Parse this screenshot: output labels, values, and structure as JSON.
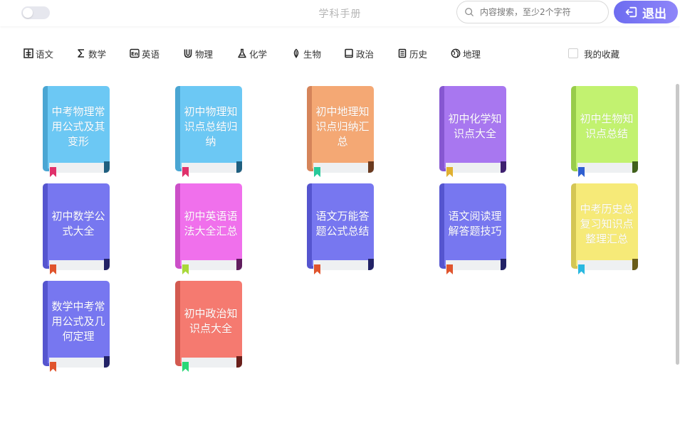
{
  "header": {
    "title": "学科手册",
    "search_placeholder": "内容搜索，至少2个字符",
    "logout_label": "退出"
  },
  "subjects": [
    {
      "label": "语文",
      "icon": "chinese-book-icon"
    },
    {
      "label": "数学",
      "icon": "sigma-icon"
    },
    {
      "label": "英语",
      "icon": "english-en-icon"
    },
    {
      "label": "物理",
      "icon": "magnet-icon"
    },
    {
      "label": "化学",
      "icon": "flask-icon"
    },
    {
      "label": "生物",
      "icon": "leaf-icon"
    },
    {
      "label": "政治",
      "icon": "book-icon"
    },
    {
      "label": "历史",
      "icon": "document-icon"
    },
    {
      "label": "地理",
      "icon": "globe-icon"
    }
  ],
  "favorites_label": "我的收藏",
  "books": [
    {
      "title": "中考物理常用公式及其变形",
      "color": "#6cc8f4",
      "spine": "#4aa6d3",
      "ribbon": "#e0316b",
      "corner": "#1f5f7f"
    },
    {
      "title": "初中物理知识点总结归纳",
      "color": "#6cc8f4",
      "spine": "#4aa6d3",
      "ribbon": "#e0316b",
      "corner": "#1f5f7f"
    },
    {
      "title": "初中地理知识点归纳汇总",
      "color": "#f4a874",
      "spine": "#d5845a",
      "ribbon": "#27c99a",
      "corner": "#6a3a1f"
    },
    {
      "title": "初中化学知识点大全",
      "color": "#a877f0",
      "spine": "#8657d1",
      "ribbon": "#e0b030",
      "corner": "#3e2070"
    },
    {
      "title": "初中生物知识点总结",
      "color": "#c2f270",
      "spine": "#98cc4a",
      "ribbon": "#2f5fd0",
      "corner": "#40601a"
    },
    {
      "title": "初中数学公式大全",
      "color": "#7777f0",
      "spine": "#5555cf",
      "ribbon": "#e0542d",
      "corner": "#222266"
    },
    {
      "title": "初中英语语法大全汇总",
      "color": "#f070ec",
      "spine": "#cc4fc8",
      "ribbon": "#a9d83a",
      "corner": "#601d5e"
    },
    {
      "title": "语文万能答题公式总结",
      "color": "#7777f0",
      "spine": "#5555cf",
      "ribbon": "#e0542d",
      "corner": "#222266"
    },
    {
      "title": "语文阅读理解答题技巧",
      "color": "#7777f0",
      "spine": "#5555cf",
      "ribbon": "#e0542d",
      "corner": "#222266"
    },
    {
      "title": "中考历史总复习知识点整理汇总",
      "color": "#f6ea78",
      "spine": "#d4c654",
      "ribbon": "#2ab8e0",
      "corner": "#6a5d1a"
    },
    {
      "title": "数学中考常用公式及几何定理",
      "color": "#7777f0",
      "spine": "#5555cf",
      "ribbon": "#e0542d",
      "corner": "#222266"
    },
    {
      "title": "初中政治知识点大全",
      "color": "#f57a70",
      "spine": "#d35a50",
      "ribbon": "#2ad877",
      "corner": "#6a1f1a"
    }
  ]
}
